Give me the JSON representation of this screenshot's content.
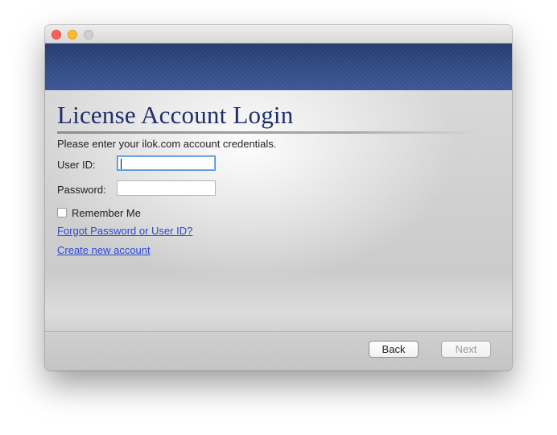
{
  "window": {
    "traffic_lights": [
      "close",
      "minimize",
      "zoom"
    ]
  },
  "page": {
    "title": "License Account Login",
    "instructions": "Please enter your ilok.com account credentials."
  },
  "form": {
    "userid_label": "User ID:",
    "userid_value": "",
    "password_label": "Password:",
    "password_value": "",
    "remember_label": "Remember Me",
    "remember_checked": false
  },
  "links": {
    "forgot": "Forgot Password or User ID?",
    "create": "Create new account"
  },
  "footer": {
    "back_label": "Back",
    "next_label": "Next",
    "next_enabled": false
  },
  "colors": {
    "title": "#1f2e6b",
    "banner": "#2e4580",
    "link": "#2b48d6",
    "focus_ring": "#4d90df"
  }
}
